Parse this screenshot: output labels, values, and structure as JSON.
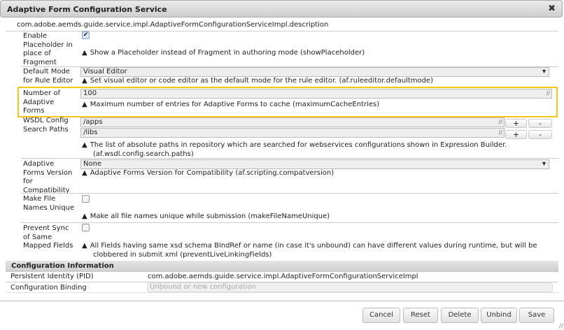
{
  "dialog": {
    "title": "Adaptive Form Configuration Service",
    "close_icon": "close-icon"
  },
  "description": "com.adobe.aemds.guide.service.impl.AdaptiveFormConfigurationServiceImpl.description",
  "properties": [
    {
      "label": [
        "Enable",
        "Placeholder in",
        "place of",
        "Fragment"
      ],
      "checked": true,
      "help": "Show a Placeholder instead of Fragment in authoring mode (showPlaceholder)"
    },
    {
      "label": [
        "Default Mode",
        "for Rule Editor"
      ],
      "value": "Visual Editor",
      "help": "Set visual editor or code editor as the default mode for the rule editor. (af.ruleeditor.defaultmode)"
    },
    {
      "label": [
        "Number of",
        "Adaptive",
        "Forms"
      ],
      "value": "100",
      "help": "Maximum number of entries for Adaptive Forms to cache (maximumCacheEntries)"
    },
    {
      "label": [
        "WSDL Config",
        "Search Paths"
      ],
      "values": [
        "/apps",
        "/libs"
      ],
      "add": "+",
      "remove": "-",
      "help": [
        "The list of absolute paths in repository which are searched for webservices configurations shown in Expression Builder.",
        "(af.wsdl.config.search.paths)"
      ]
    },
    {
      "label": [
        "Adaptive",
        "Forms Version",
        "for",
        "Compatibility"
      ],
      "value": "None",
      "help": "Adaptive Forms Version for Compatibility (af.scripting.compatversion)"
    },
    {
      "label": [
        "Make File",
        "Names Unique"
      ],
      "checked": false,
      "help": "Make all file names unique while submission (makeFileNameUnique)"
    },
    {
      "label": [
        "Prevent Sync",
        "of Same",
        "Mapped Fields"
      ],
      "checked": false,
      "help": [
        "All Fields having same xsd schema BindRef or name (in case it's unbound) can have different values during runtime, but will be",
        "clobbered in submit xml (preventLiveLinkingFields)"
      ]
    }
  ],
  "config_info": {
    "title": "Configuration Information",
    "pid_label": "Persistent Identity (PID)",
    "pid_value": "com.adobe.aemds.guide.service.impl.AdaptiveFormConfigurationServiceImpl",
    "binding_label": "Configuration Binding",
    "binding_placeholder": "Unbound or new configuration"
  },
  "buttons": {
    "cancel": "Cancel",
    "reset": "Reset",
    "delete": "Delete",
    "unbind": "Unbind",
    "save": "Save"
  },
  "warning_glyph": "▲",
  "highlight_color": "#f5c518"
}
